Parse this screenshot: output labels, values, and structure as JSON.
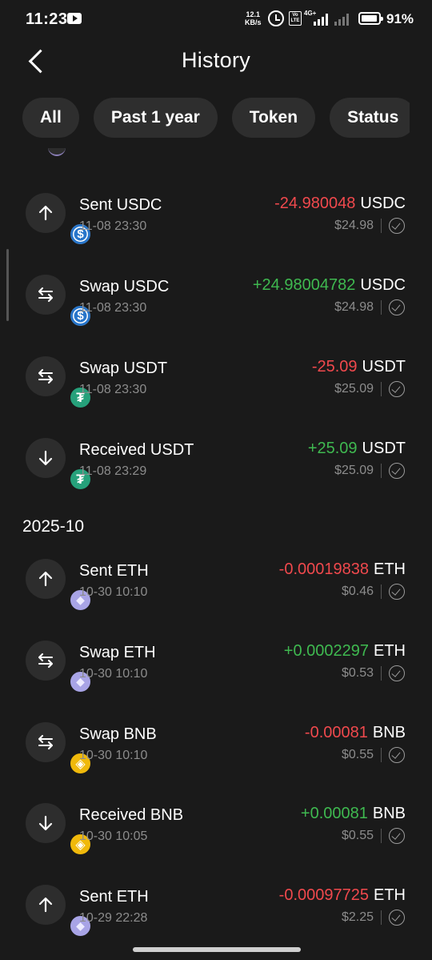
{
  "status_bar": {
    "time": "11:23",
    "net_speed_value": "12.1",
    "net_speed_unit": "KB/s",
    "volte_top": "Vo",
    "volte_bottom": "LTE",
    "network": "4G+",
    "battery": "91%"
  },
  "header": {
    "title": "History"
  },
  "filters": [
    "All",
    "Past 1 year",
    "Token",
    "Status"
  ],
  "colors": {
    "negative": "#f0494d",
    "positive": "#3fb950",
    "usdc": "#2775ca",
    "usdt": "#26a17b",
    "eth": "#a8a4e6",
    "bnb": "#f0b90b"
  },
  "groups": [
    {
      "month": "",
      "transactions": [
        {
          "type_icon": "arrow-up-icon",
          "token_icon": "usdc-icon",
          "title": "Sent USDC",
          "date": "11-08 23:30",
          "amount": "-24.980048",
          "token": "USDC",
          "fiat": "$24.98",
          "status": "check-circle-icon"
        },
        {
          "type_icon": "swap-icon",
          "token_icon": "usdc-icon",
          "title": "Swap USDC",
          "date": "11-08 23:30",
          "amount": "+24.98004782",
          "token": "USDC",
          "fiat": "$24.98",
          "status": "check-circle-icon"
        },
        {
          "type_icon": "swap-icon",
          "token_icon": "usdt-icon",
          "title": "Swap USDT",
          "date": "11-08 23:30",
          "amount": "-25.09",
          "token": "USDT",
          "fiat": "$25.09",
          "status": "check-circle-icon"
        },
        {
          "type_icon": "arrow-down-icon",
          "token_icon": "usdt-icon",
          "title": "Received USDT",
          "date": "11-08 23:29",
          "amount": "+25.09",
          "token": "USDT",
          "fiat": "$25.09",
          "status": "check-circle-icon"
        }
      ]
    },
    {
      "month": "2025-10",
      "transactions": [
        {
          "type_icon": "arrow-up-icon",
          "token_icon": "eth-icon",
          "title": "Sent ETH",
          "date": "10-30 10:10",
          "amount": "-0.00019838",
          "token": "ETH",
          "fiat": "$0.46",
          "status": "check-circle-icon"
        },
        {
          "type_icon": "swap-icon",
          "token_icon": "eth-icon",
          "title": "Swap ETH",
          "date": "10-30 10:10",
          "amount": "+0.0002297",
          "token": "ETH",
          "fiat": "$0.53",
          "status": "check-circle-icon"
        },
        {
          "type_icon": "swap-icon",
          "token_icon": "bnb-icon",
          "title": "Swap BNB",
          "date": "10-30 10:10",
          "amount": "-0.00081",
          "token": "BNB",
          "fiat": "$0.55",
          "status": "check-circle-icon"
        },
        {
          "type_icon": "arrow-down-icon",
          "token_icon": "bnb-icon",
          "title": "Received BNB",
          "date": "10-30 10:05",
          "amount": "+0.00081",
          "token": "BNB",
          "fiat": "$0.55",
          "status": "check-circle-icon"
        },
        {
          "type_icon": "arrow-up-icon",
          "token_icon": "eth-icon",
          "title": "Sent ETH",
          "date": "10-29 22:28",
          "amount": "-0.00097725",
          "token": "ETH",
          "fiat": "$2.25",
          "status": "check-circle-icon"
        }
      ]
    }
  ]
}
